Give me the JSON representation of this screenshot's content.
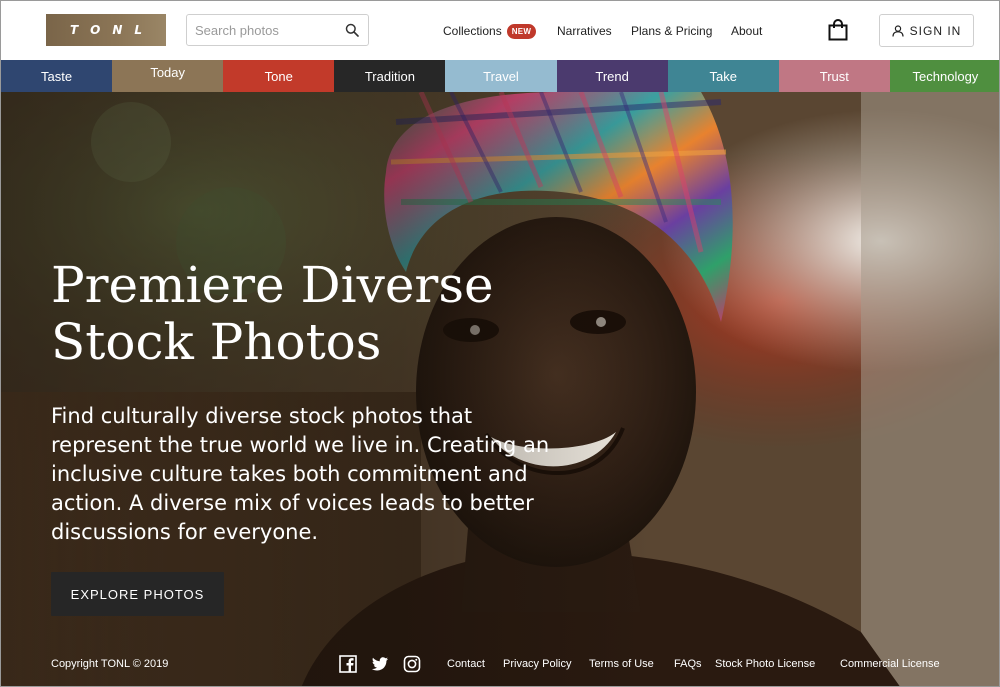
{
  "header": {
    "logo_text": "TONL",
    "search_placeholder": "Search photos",
    "search_value": "",
    "nav": {
      "collections": "Collections",
      "collections_badge": "NEW",
      "narratives": "Narratives",
      "plans": "Plans & Pricing",
      "about": "About"
    },
    "signin_label": "SIGN IN"
  },
  "categories": [
    {
      "label": "Taste",
      "color": "#2f4670"
    },
    {
      "label": "Today",
      "color": "#8c7556",
      "active": true
    },
    {
      "label": "Tone",
      "color": "#c23a2a"
    },
    {
      "label": "Tradition",
      "color": "#272727"
    },
    {
      "label": "Travel",
      "color": "#95bbd0"
    },
    {
      "label": "Trend",
      "color": "#4b3a6e"
    },
    {
      "label": "Take",
      "color": "#3f8594"
    },
    {
      "label": "Trust",
      "color": "#c07784"
    },
    {
      "label": "Technology",
      "color": "#4f8f3f"
    }
  ],
  "hero": {
    "headline_line1": "Premiere Diverse",
    "headline_line2": "Stock Photos",
    "subtext": "Find culturally diverse stock photos that represent the true world we live in. Creating an inclusive culture takes both commitment and action. A diverse mix of voices leads to better discussions for everyone.",
    "cta_label": "EXPLORE PHOTOS"
  },
  "footer": {
    "copyright": "Copyright TONL © 2019",
    "social_icons": [
      "facebook-icon",
      "twitter-icon",
      "instagram-icon"
    ],
    "links": {
      "contact": "Contact",
      "privacy": "Privacy Policy",
      "terms": "Terms of Use",
      "faqs": "FAQs",
      "stock_license": "Stock Photo License",
      "commercial_license": "Commercial License"
    }
  },
  "colors": {
    "badge": "#c0392b",
    "cta_background": "#262626",
    "logo_background": "#8b7556"
  }
}
